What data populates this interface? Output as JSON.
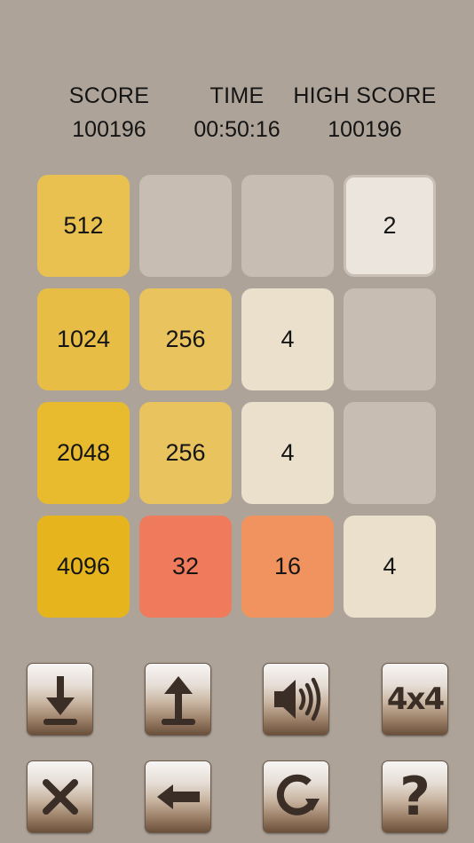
{
  "stats": {
    "score": {
      "label": "SCORE",
      "value": "100196"
    },
    "time": {
      "label": "TIME",
      "value": "00:50:16"
    },
    "high_score": {
      "label": "HIGH SCORE",
      "value": "100196"
    }
  },
  "board": {
    "rows": [
      [
        "512",
        "",
        "",
        "2"
      ],
      [
        "1024",
        "256",
        "4",
        ""
      ],
      [
        "2048",
        "256",
        "4",
        ""
      ],
      [
        "4096",
        "32",
        "16",
        "4"
      ]
    ]
  },
  "colors": {
    "background": "#ada399",
    "empty": "#c8bdb2",
    "tile_2": "#ece5dd",
    "tile_4": "#ebe0cb",
    "tile_16": "#f0935e",
    "tile_32": "#f07a5c",
    "tile_256": "#e8c35e",
    "tile_512": "#e8c150",
    "tile_1024": "#e8bd45",
    "tile_2048": "#e8ba2e",
    "tile_4096": "#e6b51e"
  },
  "controls": {
    "row1": [
      {
        "name": "save",
        "icon": "download-icon"
      },
      {
        "name": "load",
        "icon": "upload-icon"
      },
      {
        "name": "sound",
        "icon": "speaker-icon"
      },
      {
        "name": "grid-size",
        "icon": "grid-size-icon",
        "label": "4x4"
      }
    ],
    "row2": [
      {
        "name": "close",
        "icon": "close-icon"
      },
      {
        "name": "undo",
        "icon": "back-arrow-icon"
      },
      {
        "name": "restart",
        "icon": "restart-icon"
      },
      {
        "name": "help",
        "icon": "help-icon",
        "label": "?"
      }
    ]
  }
}
